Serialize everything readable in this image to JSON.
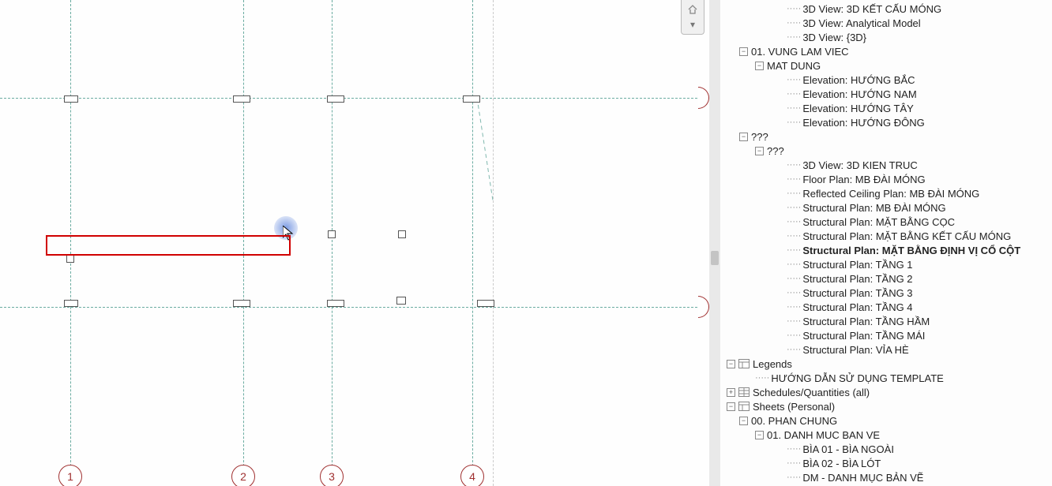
{
  "canvas": {
    "grid_labels": [
      "1",
      "2",
      "3",
      "4"
    ]
  },
  "tree": {
    "views3d": [
      "3D View: 3D KẾT CẤU MÓNG",
      "3D View: Analytical Model",
      "3D View: {3D}"
    ],
    "vung_lam_viec": "01. VUNG LAM VIEC",
    "mat_dung": "MAT DUNG",
    "elevations": [
      "Elevation: HƯỚNG BẮC",
      "Elevation: HƯỚNG NAM",
      "Elevation: HƯỚNG TÂY",
      "Elevation: HƯỚNG ĐÔNG"
    ],
    "q1": "???",
    "q2": "???",
    "plans": [
      "3D View: 3D KIEN TRUC",
      "Floor Plan: MB ĐÀI MÓNG",
      "Reflected Ceiling Plan: MB ĐÀI MÓNG",
      "Structural Plan: MB ĐÀI MÓNG",
      "Structural Plan: MẶT BẰNG CỌC",
      "Structural Plan: MẶT BẰNG KẾT CẤU MÓNG",
      "Structural Plan: MẶT BẰNG ĐỊNH VỊ CỔ CỘT",
      "Structural Plan: TẦNG 1",
      "Structural Plan: TẦNG 2",
      "Structural Plan: TẦNG 3",
      "Structural Plan: TẦNG 4",
      "Structural Plan: TẦNG HẦM",
      "Structural Plan: TẦNG MÁI",
      "Structural Plan: VỈA HÈ"
    ],
    "legends": "Legends",
    "legend_items": [
      "HƯỚNG DẪN SỬ DỤNG TEMPLATE"
    ],
    "schedules": "Schedules/Quantities (all)",
    "sheets": "Sheets (Personal)",
    "phan_chung": "00. PHAN CHUNG",
    "danh_muc": "01. DANH MUC BAN VE",
    "sheet_items": [
      "BÌA 01 - BÌA NGOÀI",
      "BÌA 02 - BÌA LÓT",
      "DM - DANH MỤC BẢN VẼ"
    ]
  }
}
